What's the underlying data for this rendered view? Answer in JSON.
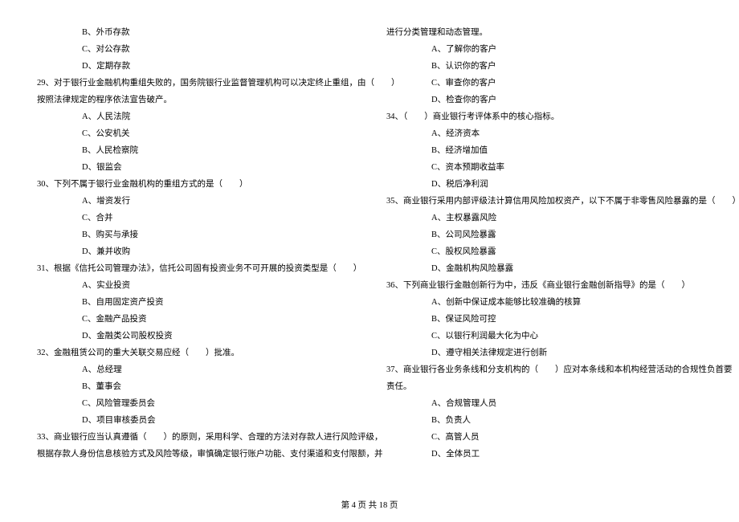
{
  "left": {
    "opts_top": [
      "B、外币存款",
      "C、对公存款",
      "D、定期存款"
    ],
    "q29": "29、对于银行业金融机构重组失败的，国务院银行业监督管理机构可以决定终止重组，由（　　）",
    "q29b": "按照法律规定的程序依法宣告破产。",
    "q29opts": [
      "A、人民法院",
      "C、公安机关",
      "B、人民检察院",
      "D、银监会"
    ],
    "q30": "30、下列不属于银行业金融机构的重组方式的是（　　）",
    "q30opts": [
      "A、增资发行",
      "C、合并",
      "B、购买与承接",
      "D、兼并收购"
    ],
    "q31": "31、根据《信托公司管理办法》，信托公司固有投资业务不可开展的投资类型是（　　）",
    "q31opts": [
      "A、实业投资",
      "B、自用固定资产投资",
      "C、金融产品投资",
      "D、金融类公司股权投资"
    ],
    "q32": "32、金融租赁公司的重大关联交易应经（　　）批准。",
    "q32opts": [
      "A、总经理",
      "B、董事会",
      "C、风险管理委员会",
      "D、项目审核委员会"
    ],
    "q33": "33、商业银行应当认真遵循（　　）的原则，采用科学、合理的方法对存款人进行风险评级，",
    "q33b": "根据存款人身份信息核验方式及风险等级，审慎确定银行账户功能、支付渠道和支付限额，并"
  },
  "right": {
    "cont": "进行分类管理和动态管理。",
    "q33opts": [
      "A、了解你的客户",
      "B、认识你的客户",
      "C、审查你的客户",
      "D、检查你的客户"
    ],
    "q34": "34、（　　）商业银行考评体系中的核心指标。",
    "q34opts": [
      "A、经济资本",
      "B、经济增加值",
      "C、资本预期收益率",
      "D、税后净利润"
    ],
    "q35": "35、商业银行采用内部评级法计算信用风险加权资产，以下不属于非零售风险暴露的是（　　）",
    "q35opts": [
      "A、主权暴露风险",
      "B、公司风险暴露",
      "C、股权风险暴露",
      "D、金融机构风险暴露"
    ],
    "q36": "36、下列商业银行金融创新行为中，违反《商业银行金融创新指导》的是（　　）",
    "q36opts": [
      "A、创新中保证成本能够比较准确的核算",
      "B、保证风险可控",
      "C、以银行利润最大化为中心",
      "D、遵守相关法律规定进行创新"
    ],
    "q37": "37、商业银行各业务条线和分支机构的（　　）应对本条线和本机构经营活动的合规性负首要",
    "q37b": "责任。",
    "q37opts": [
      "A、合规管理人员",
      "B、负责人",
      "C、高管人员",
      "D、全体员工"
    ]
  },
  "footer": "第 4 页 共 18 页"
}
